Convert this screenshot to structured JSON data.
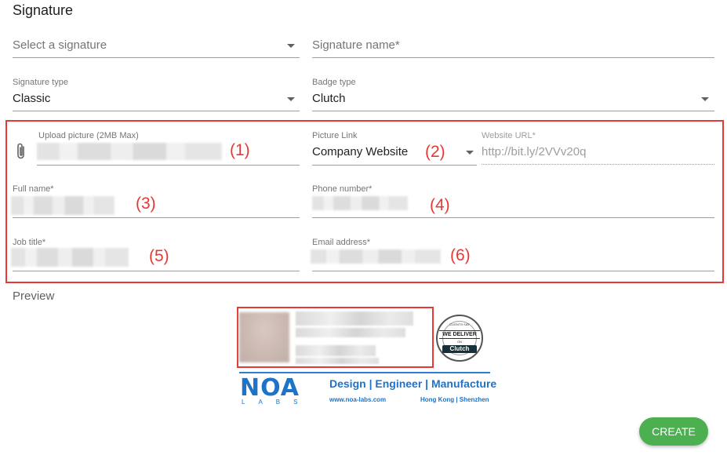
{
  "section_title": "Signature",
  "select_signature": {
    "placeholder": "Select a signature"
  },
  "signature_name": {
    "placeholder": "Signature name*"
  },
  "signature_type": {
    "label": "Signature type",
    "value": "Classic"
  },
  "badge_type": {
    "label": "Badge type",
    "value": "Clutch"
  },
  "upload_picture": {
    "label": "Upload picture (2MB Max)"
  },
  "picture_link": {
    "label": "Picture Link",
    "value": "Company Website"
  },
  "website_url": {
    "label": "Website URL*",
    "value": "http://bit.ly/2VVv20q"
  },
  "full_name": {
    "label": "Full name*"
  },
  "phone_number": {
    "label": "Phone number*"
  },
  "job_title": {
    "label": "Job title*"
  },
  "email_address": {
    "label": "Email address*"
  },
  "callouts": [
    "(1)",
    "(2)",
    "(3)",
    "(4)",
    "(5)",
    "(6)"
  ],
  "preview": {
    "label": "Preview",
    "badge": {
      "line1": "CLIENTS SAY",
      "line2": "WE DELIVER",
      "line3": "ON",
      "line4": "Clutch"
    },
    "logo": {
      "name": "NOA",
      "sub": "LABS",
      "tagline": "Design | Engineer | Manufacture",
      "url": "www.noa-labs.com",
      "location": "Hong Kong | Shenzhen"
    }
  },
  "create_button": "CREATE",
  "colors": {
    "accent_red": "#e53935",
    "create_green": "#4caf50",
    "brand_blue": "#1e73c8"
  },
  "icons": {
    "attachment": "paperclip-icon",
    "dropdown": "chevron-down-icon"
  }
}
